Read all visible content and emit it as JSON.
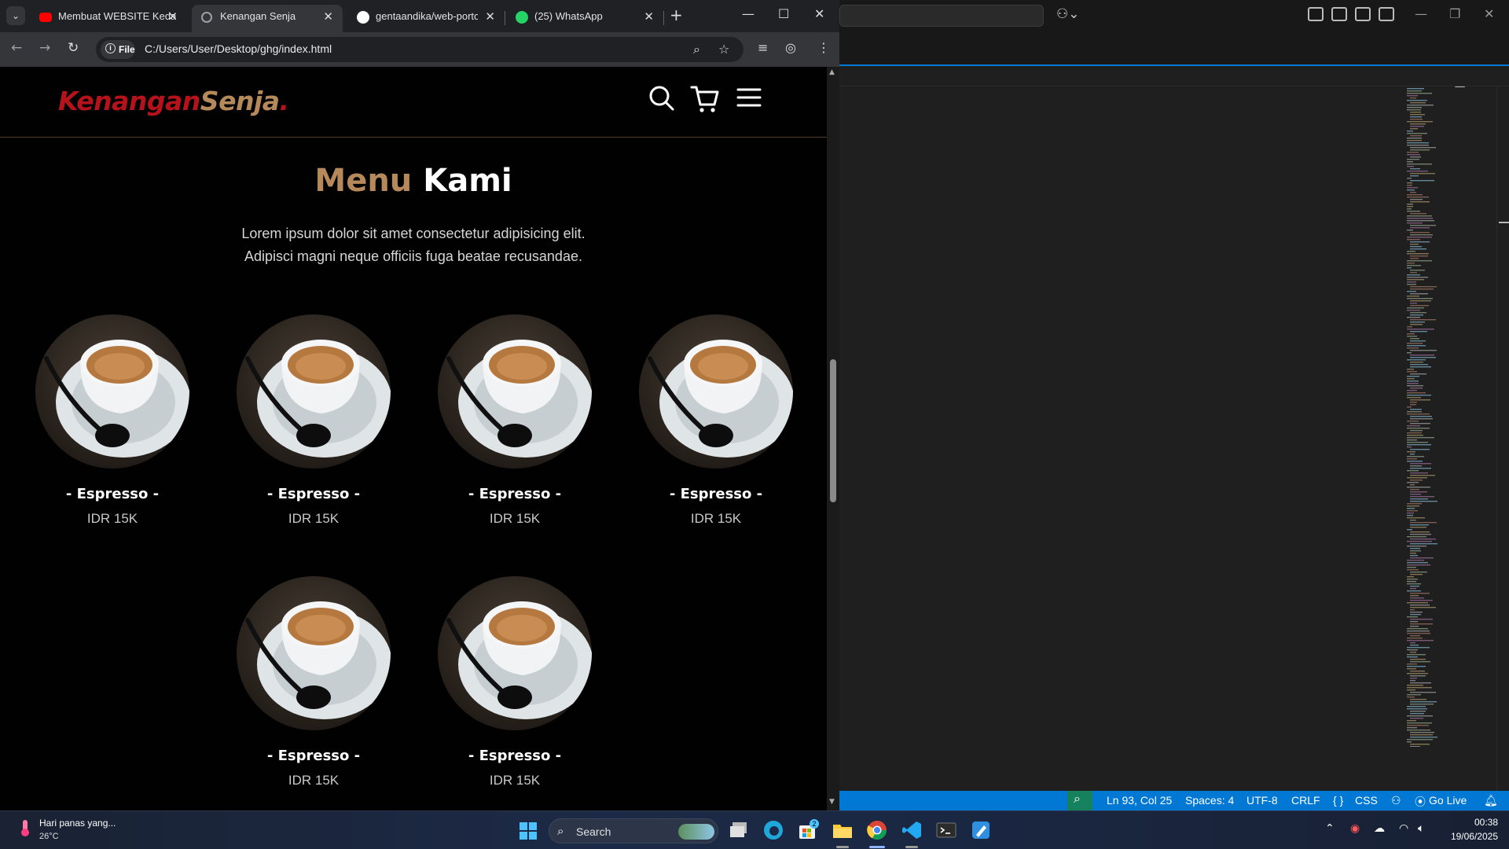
{
  "chrome": {
    "tabs": [
      {
        "title": "Membuat WEBSITE Kedai",
        "icon": "youtube-icon"
      },
      {
        "title": "Kenangan Senja",
        "icon": "globe-icon"
      },
      {
        "title": "gentaandika/web-portof",
        "icon": "github-icon"
      },
      {
        "title": "(25) WhatsApp",
        "icon": "whatsapp-icon"
      }
    ],
    "new_tab": "+",
    "file_chip": "File",
    "url": "C:/Users/User/Desktop/ghg/index.html"
  },
  "site": {
    "logo_part1": "Kenangan",
    "logo_part2": "Senja",
    "logo_dot": ".",
    "menu_title_1": "Menu",
    "menu_title_2": "Kami",
    "menu_desc": "Lorem ipsum dolor sit amet consectetur adipisicing elit. Adipisci magni neque officiis fuga beatae recusandae.",
    "items": [
      {
        "name": "- Espresso -",
        "price": "IDR 15K"
      },
      {
        "name": "- Espresso -",
        "price": "IDR 15K"
      },
      {
        "name": "- Espresso -",
        "price": "IDR 15K"
      },
      {
        "name": "- Espresso -",
        "price": "IDR 15K"
      },
      {
        "name": "- Espresso -",
        "price": "IDR 15K"
      },
      {
        "name": "- Espresso -",
        "price": "IDR 15K"
      }
    ]
  },
  "vscode": {
    "status": {
      "position": "Ln 93, Col 25",
      "spaces": "Spaces: 4",
      "encoding": "UTF-8",
      "eol": "CRLF",
      "language": "CSS",
      "golive": "Go Live"
    }
  },
  "taskbar": {
    "weather_text": "Hari panas yang...",
    "weather_temp": "26°C",
    "search_label": "Search",
    "store_badge": "2",
    "time": "00:38",
    "date": "19/06/2025"
  },
  "colors": {
    "logo_red": "#b6121b",
    "logo_gold": "#b6895b",
    "vscode_status": "#0078d4"
  }
}
